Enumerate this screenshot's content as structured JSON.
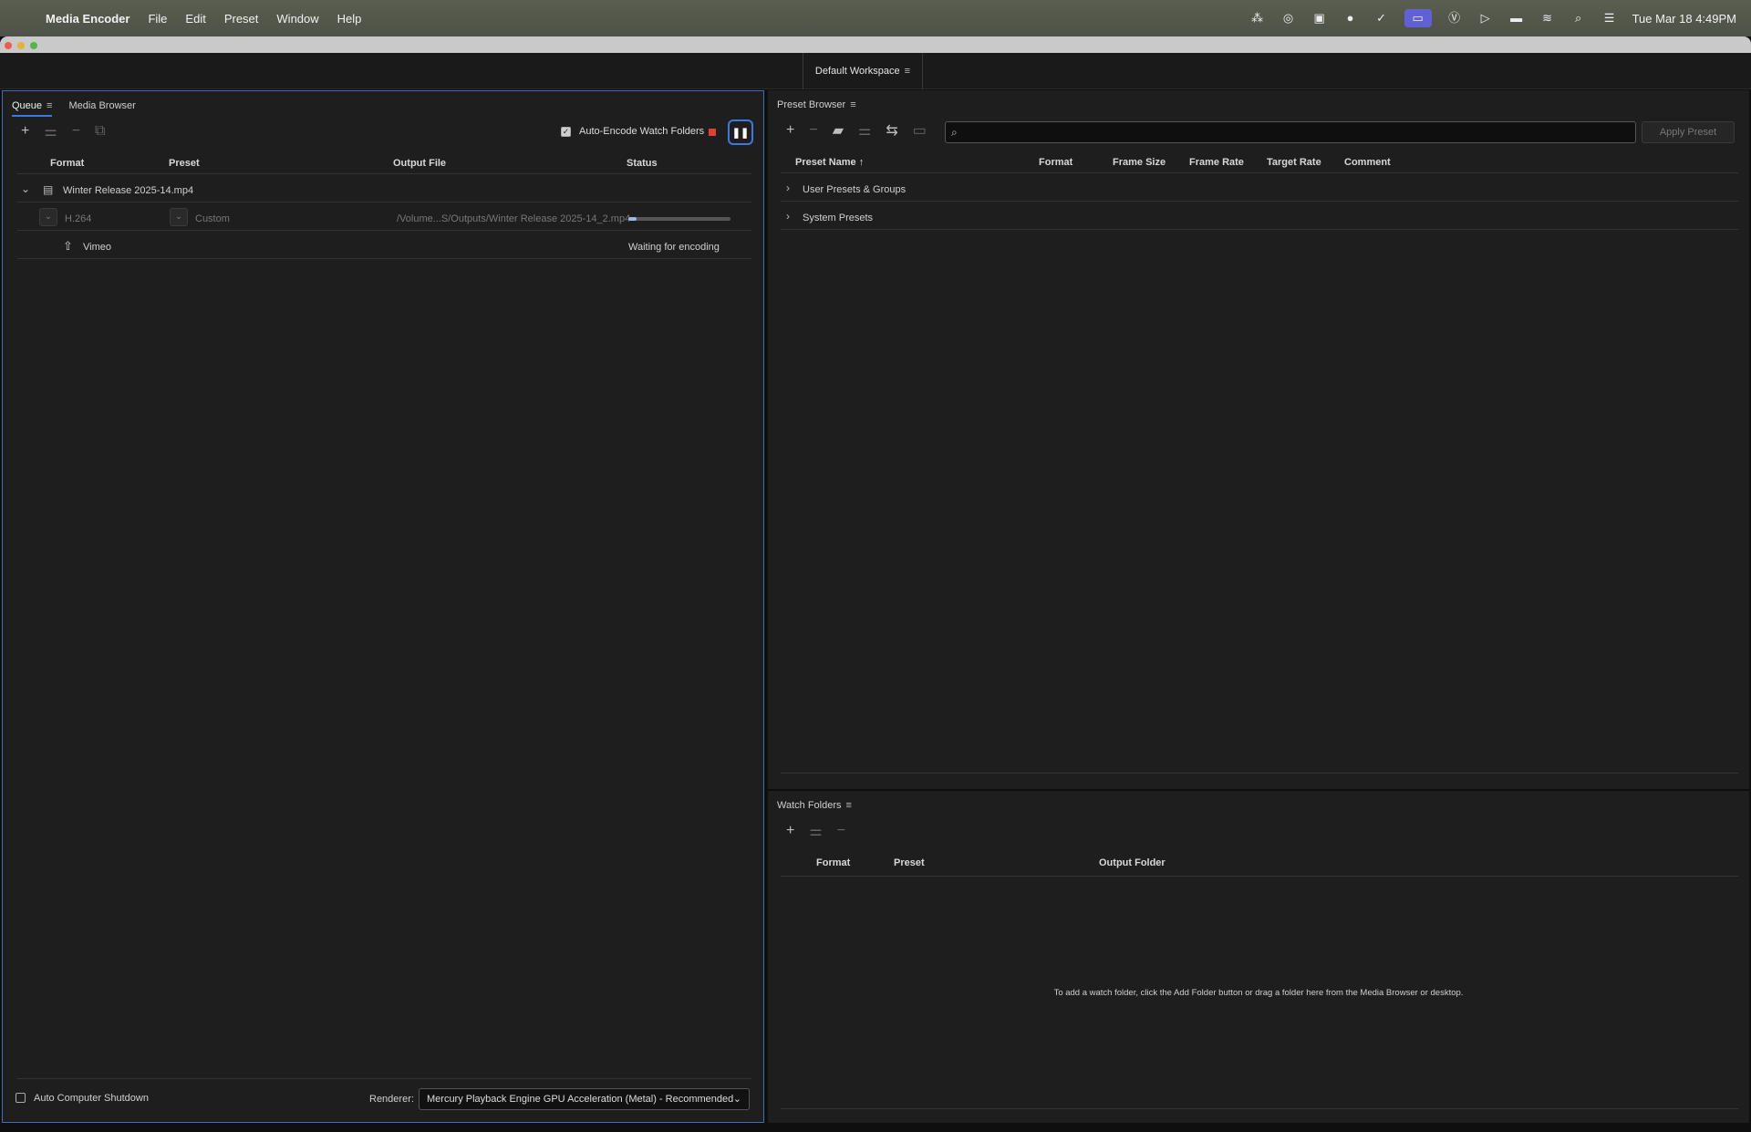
{
  "menubar": {
    "app_name": "Media Encoder",
    "items": [
      "File",
      "Edit",
      "Preset",
      "Window",
      "Help"
    ],
    "clock": "Tue Mar 18  4:49PM"
  },
  "workspace": {
    "label": "Default Workspace"
  },
  "queue_panel": {
    "tabs": [
      "Queue",
      "Media Browser"
    ],
    "auto_encode_label": "Auto-Encode Watch Folders",
    "auto_encode_checked": true,
    "columns": [
      "Format",
      "Preset",
      "Output File",
      "Status"
    ],
    "source_item": {
      "name": "Winter Release 2025-14.mp4"
    },
    "output_row": {
      "format": "H.264",
      "preset": "Custom",
      "output_file": "/Volume...S/Outputs/Winter Release 2025-14_2.mp4",
      "progress": 0.08
    },
    "publish_row": {
      "destination": "Vimeo",
      "status": "Waiting for encoding"
    },
    "auto_shutdown_label": "Auto Computer Shutdown",
    "renderer_label": "Renderer:",
    "renderer_value": "Mercury Playback Engine GPU Acceleration (Metal) - Recommended"
  },
  "preset_browser": {
    "title": "Preset Browser",
    "search_placeholder": "",
    "apply_button": "Apply Preset",
    "columns": [
      "Preset Name",
      "Format",
      "Frame Size",
      "Frame Rate",
      "Target Rate",
      "Comment"
    ],
    "groups": [
      "User Presets & Groups",
      "System Presets"
    ]
  },
  "watch_folders": {
    "title": "Watch Folders",
    "columns": [
      "Format",
      "Preset",
      "Output Folder"
    ],
    "empty_message": "To add a watch folder, click the Add Folder button or drag a folder here from the Media Browser or desktop."
  },
  "colors": {
    "accent": "#3a7ae0",
    "stop": "#e0402f",
    "panel": "#1e1e1e"
  }
}
